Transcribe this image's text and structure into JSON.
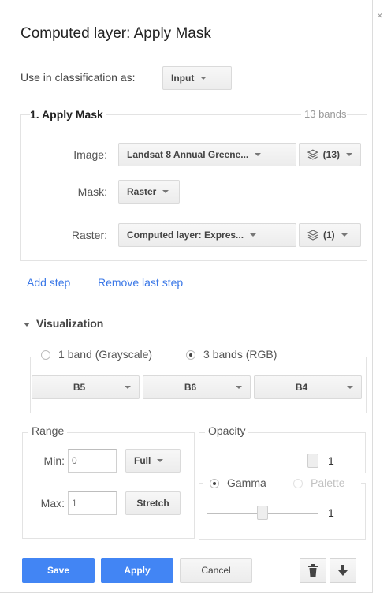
{
  "dialog": {
    "close_glyph": "×",
    "title": "Computed layer: Apply Mask"
  },
  "classification": {
    "label": "Use in classification as:",
    "value": "Input"
  },
  "step": {
    "title": "1. Apply Mask",
    "bands": "13 bands",
    "rows": {
      "image": {
        "label": "Image:",
        "value": "Landsat 8 Annual Greene...",
        "band_count": "(13)"
      },
      "mask": {
        "label": "Mask:",
        "value": "Raster"
      },
      "raster": {
        "label": "Raster:",
        "value": "Computed layer: Expres...",
        "band_count": "(1)"
      }
    }
  },
  "links": {
    "add_step": "Add step",
    "remove_step": "Remove last step"
  },
  "visualization": {
    "heading": "Visualization",
    "mode_grayscale": "1 band (Grayscale)",
    "mode_rgb": "3 bands (RGB)",
    "selected_mode": "rgb",
    "bands": [
      "B5",
      "B6",
      "B4"
    ],
    "range": {
      "label": "Range",
      "min_label": "Min:",
      "min_placeholder": "0",
      "max_label": "Max:",
      "max_placeholder": "1",
      "full_button": "Full",
      "stretch_button": "Stretch"
    },
    "opacity": {
      "label": "Opacity",
      "value": "1",
      "level": 1.0
    },
    "gamma": {
      "label": "Gamma",
      "value": "1",
      "selected": true
    },
    "palette": {
      "label": "Palette",
      "selected": false
    }
  },
  "footer": {
    "save": "Save",
    "apply": "Apply",
    "cancel": "Cancel",
    "delete_icon": "trash-icon",
    "download_icon": "download-arrow-icon"
  },
  "colors": {
    "accent": "#4285f4",
    "link": "#3b78e7"
  }
}
